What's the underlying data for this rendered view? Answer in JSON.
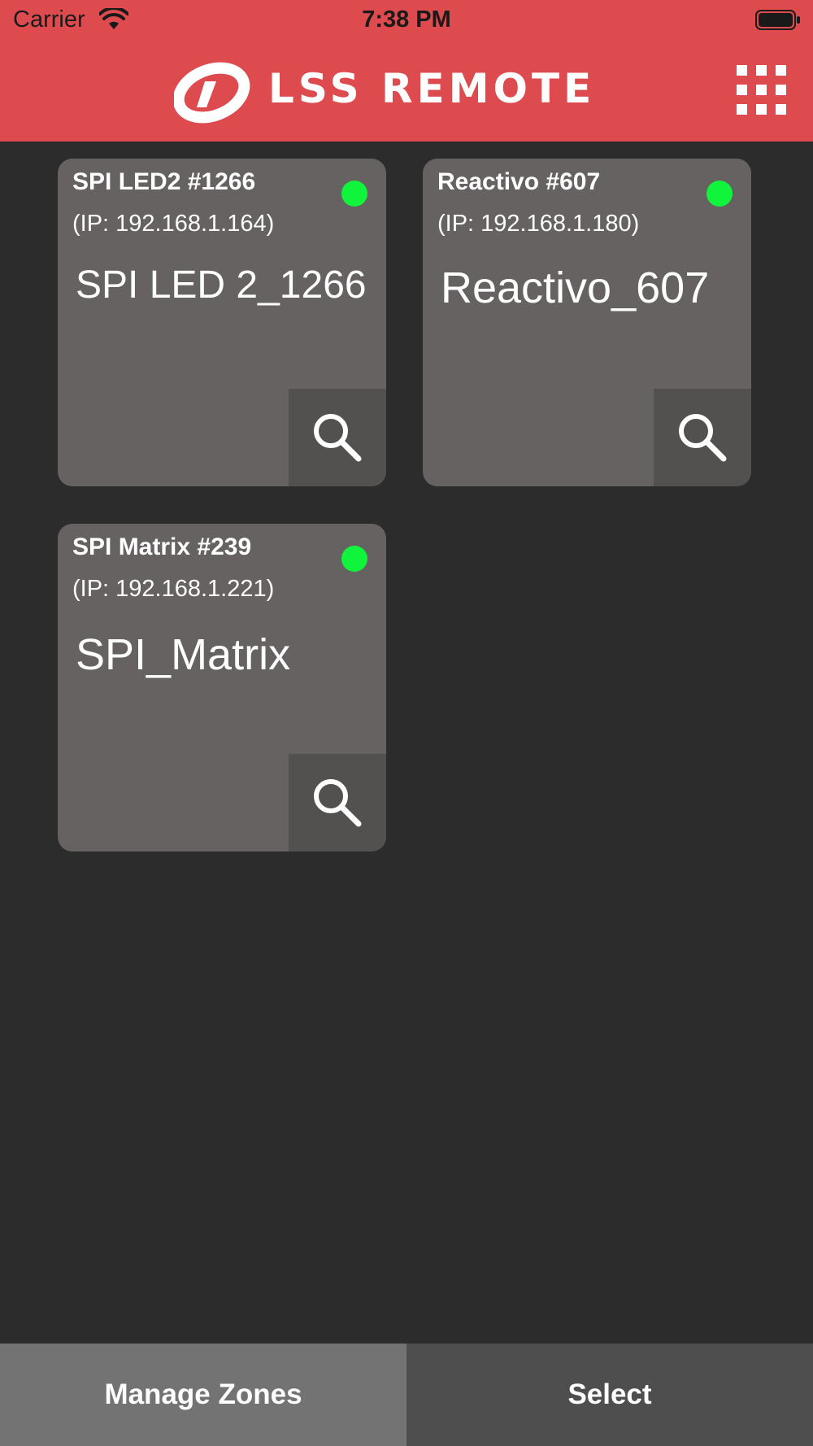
{
  "status_bar": {
    "carrier": "Carrier",
    "time": "7:38 PM",
    "icons": [
      "wifi-icon",
      "battery-icon"
    ]
  },
  "header": {
    "logo_text": "LSS REMOTE",
    "background_color": "#dd4b4f",
    "menu_icon": "grid-menu-icon"
  },
  "devices": [
    {
      "title": "SPI LED2 #1266",
      "ip": "(IP: 192.168.1.164)",
      "name": "SPI LED 2_1266",
      "status": "online",
      "status_color": "#10f53b"
    },
    {
      "title": "Reactivo #607",
      "ip": "(IP: 192.168.1.180)",
      "name": "Reactivo_607",
      "status": "online",
      "status_color": "#10f53b"
    },
    {
      "title": "SPI Matrix #239",
      "ip": "(IP: 192.168.1.221)",
      "name": "SPI_Matrix",
      "status": "online",
      "status_color": "#10f53b"
    }
  ],
  "footer": {
    "manage_zones_label": "Manage Zones",
    "select_label": "Select"
  }
}
